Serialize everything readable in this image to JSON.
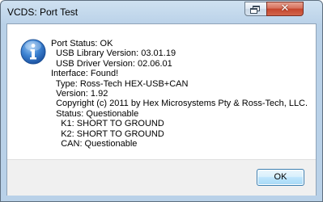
{
  "window": {
    "title": "VCDS: Port Test",
    "close_glyph": "✕"
  },
  "message": {
    "icon": "info-icon",
    "lines": [
      "Port Status: OK",
      "  USB Library Version: 03.01.19",
      "  USB Driver Version: 02.06.01",
      "Interface: Found!",
      "  Type: Ross-Tech HEX-USB+CAN",
      "  Version: 1.92",
      "  Copyright (c) 2011 by Hex Microsystems Pty & Ross-Tech, LLC.",
      "  Status: Questionable",
      "    K1: SHORT TO GROUND",
      "    K2: SHORT TO GROUND",
      "    CAN: Questionable"
    ]
  },
  "buttons": {
    "ok_label": "OK"
  },
  "colors": {
    "title_bar": "#b9d1e8",
    "close_button": "#c5452c",
    "info_icon": "#2a6fc4",
    "ok_border": "#3c7fb1"
  }
}
